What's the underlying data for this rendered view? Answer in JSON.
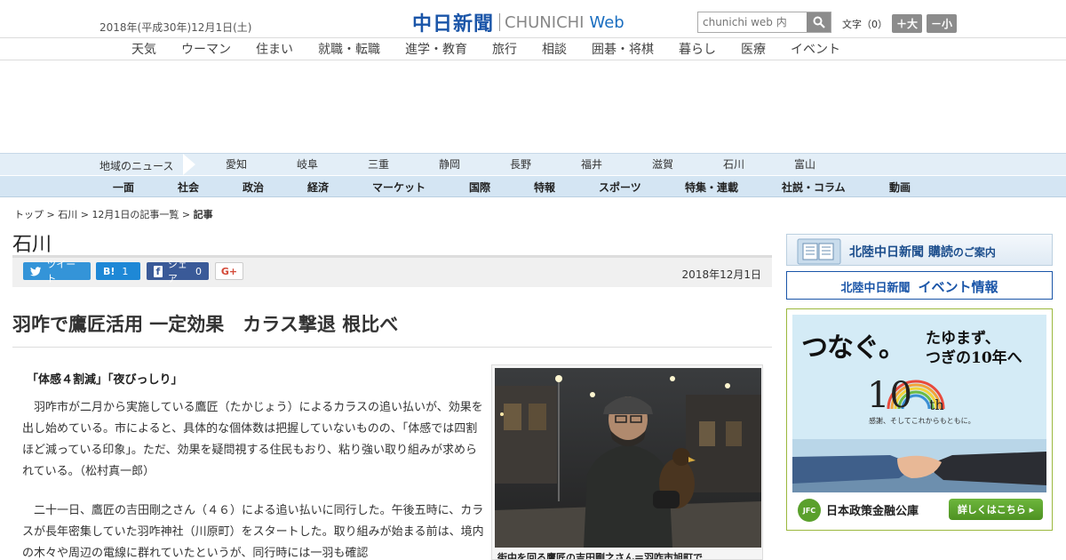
{
  "header": {
    "date": "2018年(平成30年)12月1日(土)",
    "logo_jp": "中日新聞",
    "logo_en": "CHUNICHI",
    "logo_web": "Web",
    "search_placeholder": "chunichi web 内",
    "font_label": "文字（0）",
    "font_bigger": "＋大",
    "font_smaller": "－小"
  },
  "top_nav": [
    "天気",
    "ウーマン",
    "住まい",
    "就職・転職",
    "進学・教育",
    "旅行",
    "相談",
    "囲碁・将棋",
    "暮らし",
    "医療",
    "イベント"
  ],
  "region_nav": {
    "label": "地域のニュース",
    "items": [
      "愛知",
      "岐阜",
      "三重",
      "静岡",
      "長野",
      "福井",
      "滋賀",
      "石川",
      "富山"
    ]
  },
  "category_nav": [
    "一面",
    "社会",
    "政治",
    "経済",
    "マーケット",
    "国際",
    "特報",
    "スポーツ",
    "特集・連載",
    "社説・コラム",
    "動画"
  ],
  "breadcrumb": {
    "top": "トップ",
    "sep": " > ",
    "region": "石川",
    "list": "12月1日の記事一覧",
    "current": "記事"
  },
  "section_title": "石川",
  "share": {
    "tweet": "ツイート",
    "hatena_label": "B!",
    "hatena_count": "1",
    "facebook": "シェア",
    "facebook_count": "0",
    "gplus": "G+",
    "publish_date": "2018年12月1日"
  },
  "article": {
    "headline": "羽咋で鷹匠活用 一定効果　カラス撃退 根比べ",
    "subhead": "「体感４割減」「夜びっしり」",
    "para1": "羽咋市が二月から実施している鷹匠（たかじょう）によるカラスの追い払いが、効果を出し始めている。市によると、具体的な個体数は把握していないものの、「体感では四割ほど減っている印象」。ただ、効果を疑問視する住民もおり、粘り強い取り組みが求められている。（松村真一郎）",
    "para2": "二十一日、鷹匠の吉田剛之さん（４６）による追い払いに同行した。午後五時に、カラスが長年密集していた羽咋神社（川原町）をスタートした。取り組みが始まる前は、境内の木々や周辺の電線に群れていたというが、同行時には一羽も確認",
    "photo_caption": "街中を回る鷹匠の吉田剛之さん＝羽咋市旭町で"
  },
  "sidebar": {
    "subscribe_title": "北陸中日新聞",
    "subscribe_rest": "購読",
    "subscribe_guide": "のご案内",
    "event_paper": "北陸中日新聞",
    "event_title": "イベント情報",
    "ad": {
      "line1": "つなぐ。",
      "line2a": "たゆまず、",
      "line2b": "つぎの10年へ",
      "ten": "10",
      "th": "th",
      "sub": "感謝、そしてこれからもともに。",
      "logo": "JFC",
      "org": "日本政策金融公庫",
      "button": "詳しくはこちら ▸"
    }
  },
  "colors": {
    "brand": "#1a55a8",
    "region_bg": "#e3eef7",
    "category_bg": "#d4e5f3",
    "ad_green": "#5aa02c"
  }
}
